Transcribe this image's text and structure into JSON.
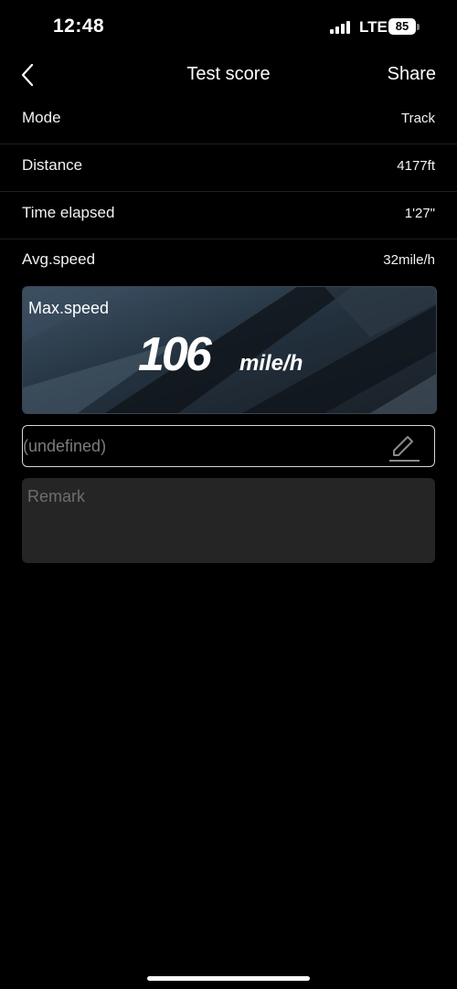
{
  "status_bar": {
    "time": "12:48",
    "network": "LTE",
    "battery": "85",
    "signal_bars": 4
  },
  "nav": {
    "back_icon": "chevron-left-icon",
    "title": "Test score",
    "share_label": "Share"
  },
  "stats": [
    {
      "label": "Mode",
      "value": "Track"
    },
    {
      "label": "Distance",
      "value": "4177ft"
    },
    {
      "label": "Time elapsed",
      "value": "1'27\""
    },
    {
      "label": "Avg.speed",
      "value": "32mile/h"
    }
  ],
  "max_speed": {
    "label": "Max.speed",
    "value": "106",
    "unit": "mile/h"
  },
  "name_field": {
    "placeholder": "(undefined)",
    "edit_icon": "pencil-edit-icon"
  },
  "remark": {
    "placeholder": "Remark"
  },
  "colors": {
    "background": "#000000",
    "card_background": "#22303d",
    "remark_background": "#252525",
    "placeholder_text": "#7c7c7c"
  }
}
